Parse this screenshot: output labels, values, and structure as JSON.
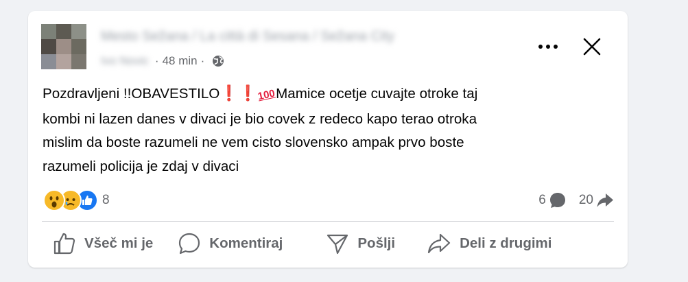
{
  "post": {
    "author": "Mesto Sežana / La città di Sesana / Sežana City",
    "subname": "Ivo Novic",
    "time": "48 min",
    "audience_icon": "globe-icon",
    "text_lines": [
      "Pozdravljeni !!OBAVESTILO",
      "Mamice ocetje cuvajte otroke taj",
      "kombi ni lazen danes v divaci je bio covek z redeco kapo terao otroka",
      "mislim da boste razumeli ne vem cisto slovensko ampak prvo boste",
      "razumeli policija je zdaj v divaci"
    ],
    "emoji": {
      "exclamation": "❗",
      "hundred": "100"
    }
  },
  "reactions": {
    "types": [
      "wow",
      "sad",
      "like"
    ],
    "count": "8"
  },
  "stats": {
    "comments": "6",
    "shares": "20"
  },
  "actions": {
    "like": "Všeč mi je",
    "comment": "Komentiraj",
    "send": "Pošlji",
    "share": "Deli z drugimi"
  },
  "colors": {
    "background": "#f0f2f5",
    "card": "#ffffff",
    "secondary_text": "#65676b",
    "like_blue": "#1877f2",
    "reaction_yellow": "#f7b928",
    "exclamation_red": "#e41e3f"
  }
}
